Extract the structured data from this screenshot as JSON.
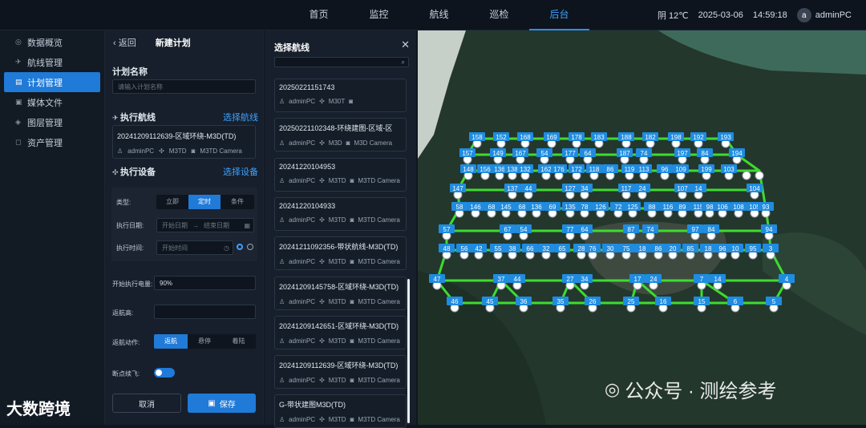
{
  "topbar": {
    "nav": [
      "首页",
      "监控",
      "航线",
      "巡检",
      "后台"
    ],
    "active_nav": "后台",
    "weather": "阴 12℃",
    "date": "2025-03-06",
    "time": "14:59:18",
    "avatar_letter": "a",
    "user": "adminPC"
  },
  "sidebar": {
    "items": [
      {
        "label": "数据概览",
        "icon": "dashboard-icon"
      },
      {
        "label": "航线管理",
        "icon": "route-icon"
      },
      {
        "label": "计划管理",
        "icon": "plan-icon"
      },
      {
        "label": "媒体文件",
        "icon": "media-icon"
      },
      {
        "label": "图层管理",
        "icon": "layer-icon"
      },
      {
        "label": "资产管理",
        "icon": "asset-icon"
      }
    ],
    "active": "计划管理"
  },
  "form": {
    "back_label": "返回",
    "title": "新建计划",
    "plan_name_label": "计划名称",
    "plan_name_placeholder": "请输入计划名称",
    "route_label": "执行航线",
    "route_link": "选择航线",
    "selected_route": {
      "name": "20241209112639-区域环绕-M3D(TD)",
      "user": "adminPC",
      "drone": "M3TD",
      "camera": "M3TD Camera"
    },
    "device_label": "执行设备",
    "device_link": "选择设备",
    "type_label": "类型:",
    "type_options": [
      "立即",
      "定时",
      "条件"
    ],
    "type_selected": "定时",
    "date_label": "执行日期:",
    "date_start_placeholder": "开始日期",
    "date_sep": "→",
    "date_end_placeholder": "结束日期",
    "time_label": "执行时间:",
    "time_placeholder": "开始时间",
    "battery_label": "开始执行电量:",
    "battery_value": "90%",
    "rth_height_label": "返航高:",
    "rth_action_label": "返航动作:",
    "rth_options": [
      "返航",
      "悬停",
      "着陆"
    ],
    "rth_selected": "返航",
    "resume_label": "断点续飞:",
    "cancel": "取消",
    "save": "保存"
  },
  "chooser": {
    "title": "选择航线",
    "routes": [
      {
        "name": "20250221151743",
        "user": "adminPC",
        "drone": "M30T",
        "camera": ""
      },
      {
        "name": "20250221102348-环绕建图-区域-区",
        "user": "adminPC",
        "drone": "M3D",
        "camera": "M3D Camera"
      },
      {
        "name": "20241220104953",
        "user": "adminPC",
        "drone": "M3TD",
        "camera": "M3TD Camera"
      },
      {
        "name": "20241220104933",
        "user": "adminPC",
        "drone": "M3TD",
        "camera": "M3TD Camera"
      },
      {
        "name": "20241211092356-带状航线-M3D(TD)",
        "user": "adminPC",
        "drone": "M3TD",
        "camera": "M3TD Camera"
      },
      {
        "name": "20241209145758-区域环绕-M3D(TD)",
        "user": "adminPC",
        "drone": "M3TD",
        "camera": "M3TD Camera"
      },
      {
        "name": "20241209142651-区域环绕-M3D(TD)",
        "user": "adminPC",
        "drone": "M3TD",
        "camera": "M3TD Camera"
      },
      {
        "name": "20241209112639-区域环绕-M3D(TD)",
        "user": "adminPC",
        "drone": "M3TD",
        "camera": "M3TD Camera"
      },
      {
        "name": "G-带状建图M3D(TD)",
        "user": "adminPC",
        "drone": "M3TD",
        "camera": "M3TD Camera"
      }
    ]
  },
  "map": {
    "waypoints_top": [
      "158",
      "152",
      "168",
      "169",
      "178",
      "183",
      "188",
      "182",
      "198",
      "192",
      "193"
    ],
    "waypoints_r2": [
      "157",
      "149",
      "167",
      "54",
      "177",
      "64",
      "187",
      "74",
      "197",
      "84",
      "194"
    ],
    "waypoints_r3": [
      "148",
      "156",
      "136",
      "138",
      "132",
      "162",
      "176",
      "172",
      "118",
      "86",
      "119",
      "113",
      "96",
      "109",
      "199",
      "103"
    ],
    "waypoints_r4": [
      "147",
      "137",
      "44",
      "127",
      "34",
      "117",
      "24",
      "107",
      "14",
      "104"
    ],
    "waypoints_r5": [
      "58",
      "146",
      "68",
      "145",
      "68",
      "136",
      "69",
      "135",
      "78",
      "126",
      "72",
      "125",
      "88",
      "116",
      "89",
      "115",
      "98",
      "106",
      "108",
      "105",
      "93"
    ],
    "waypoints_r6": [
      "57",
      "67",
      "54",
      "77",
      "64",
      "87",
      "74",
      "97",
      "84",
      "94"
    ],
    "waypoints_r7": [
      "48",
      "56",
      "42",
      "55",
      "38",
      "66",
      "32",
      "65",
      "28",
      "76",
      "30",
      "75",
      "18",
      "86",
      "20",
      "85",
      "18",
      "96",
      "10",
      "95",
      "3"
    ],
    "waypoints_r8": [
      "47",
      "37",
      "44",
      "27",
      "34",
      "17",
      "24",
      "7",
      "14",
      "4"
    ],
    "waypoints_bottom": [
      "46",
      "45",
      "36",
      "35",
      "26",
      "25",
      "16",
      "15",
      "6",
      "5"
    ],
    "watermark": "公众号 · 测绘参考",
    "brand": "大数跨境"
  }
}
